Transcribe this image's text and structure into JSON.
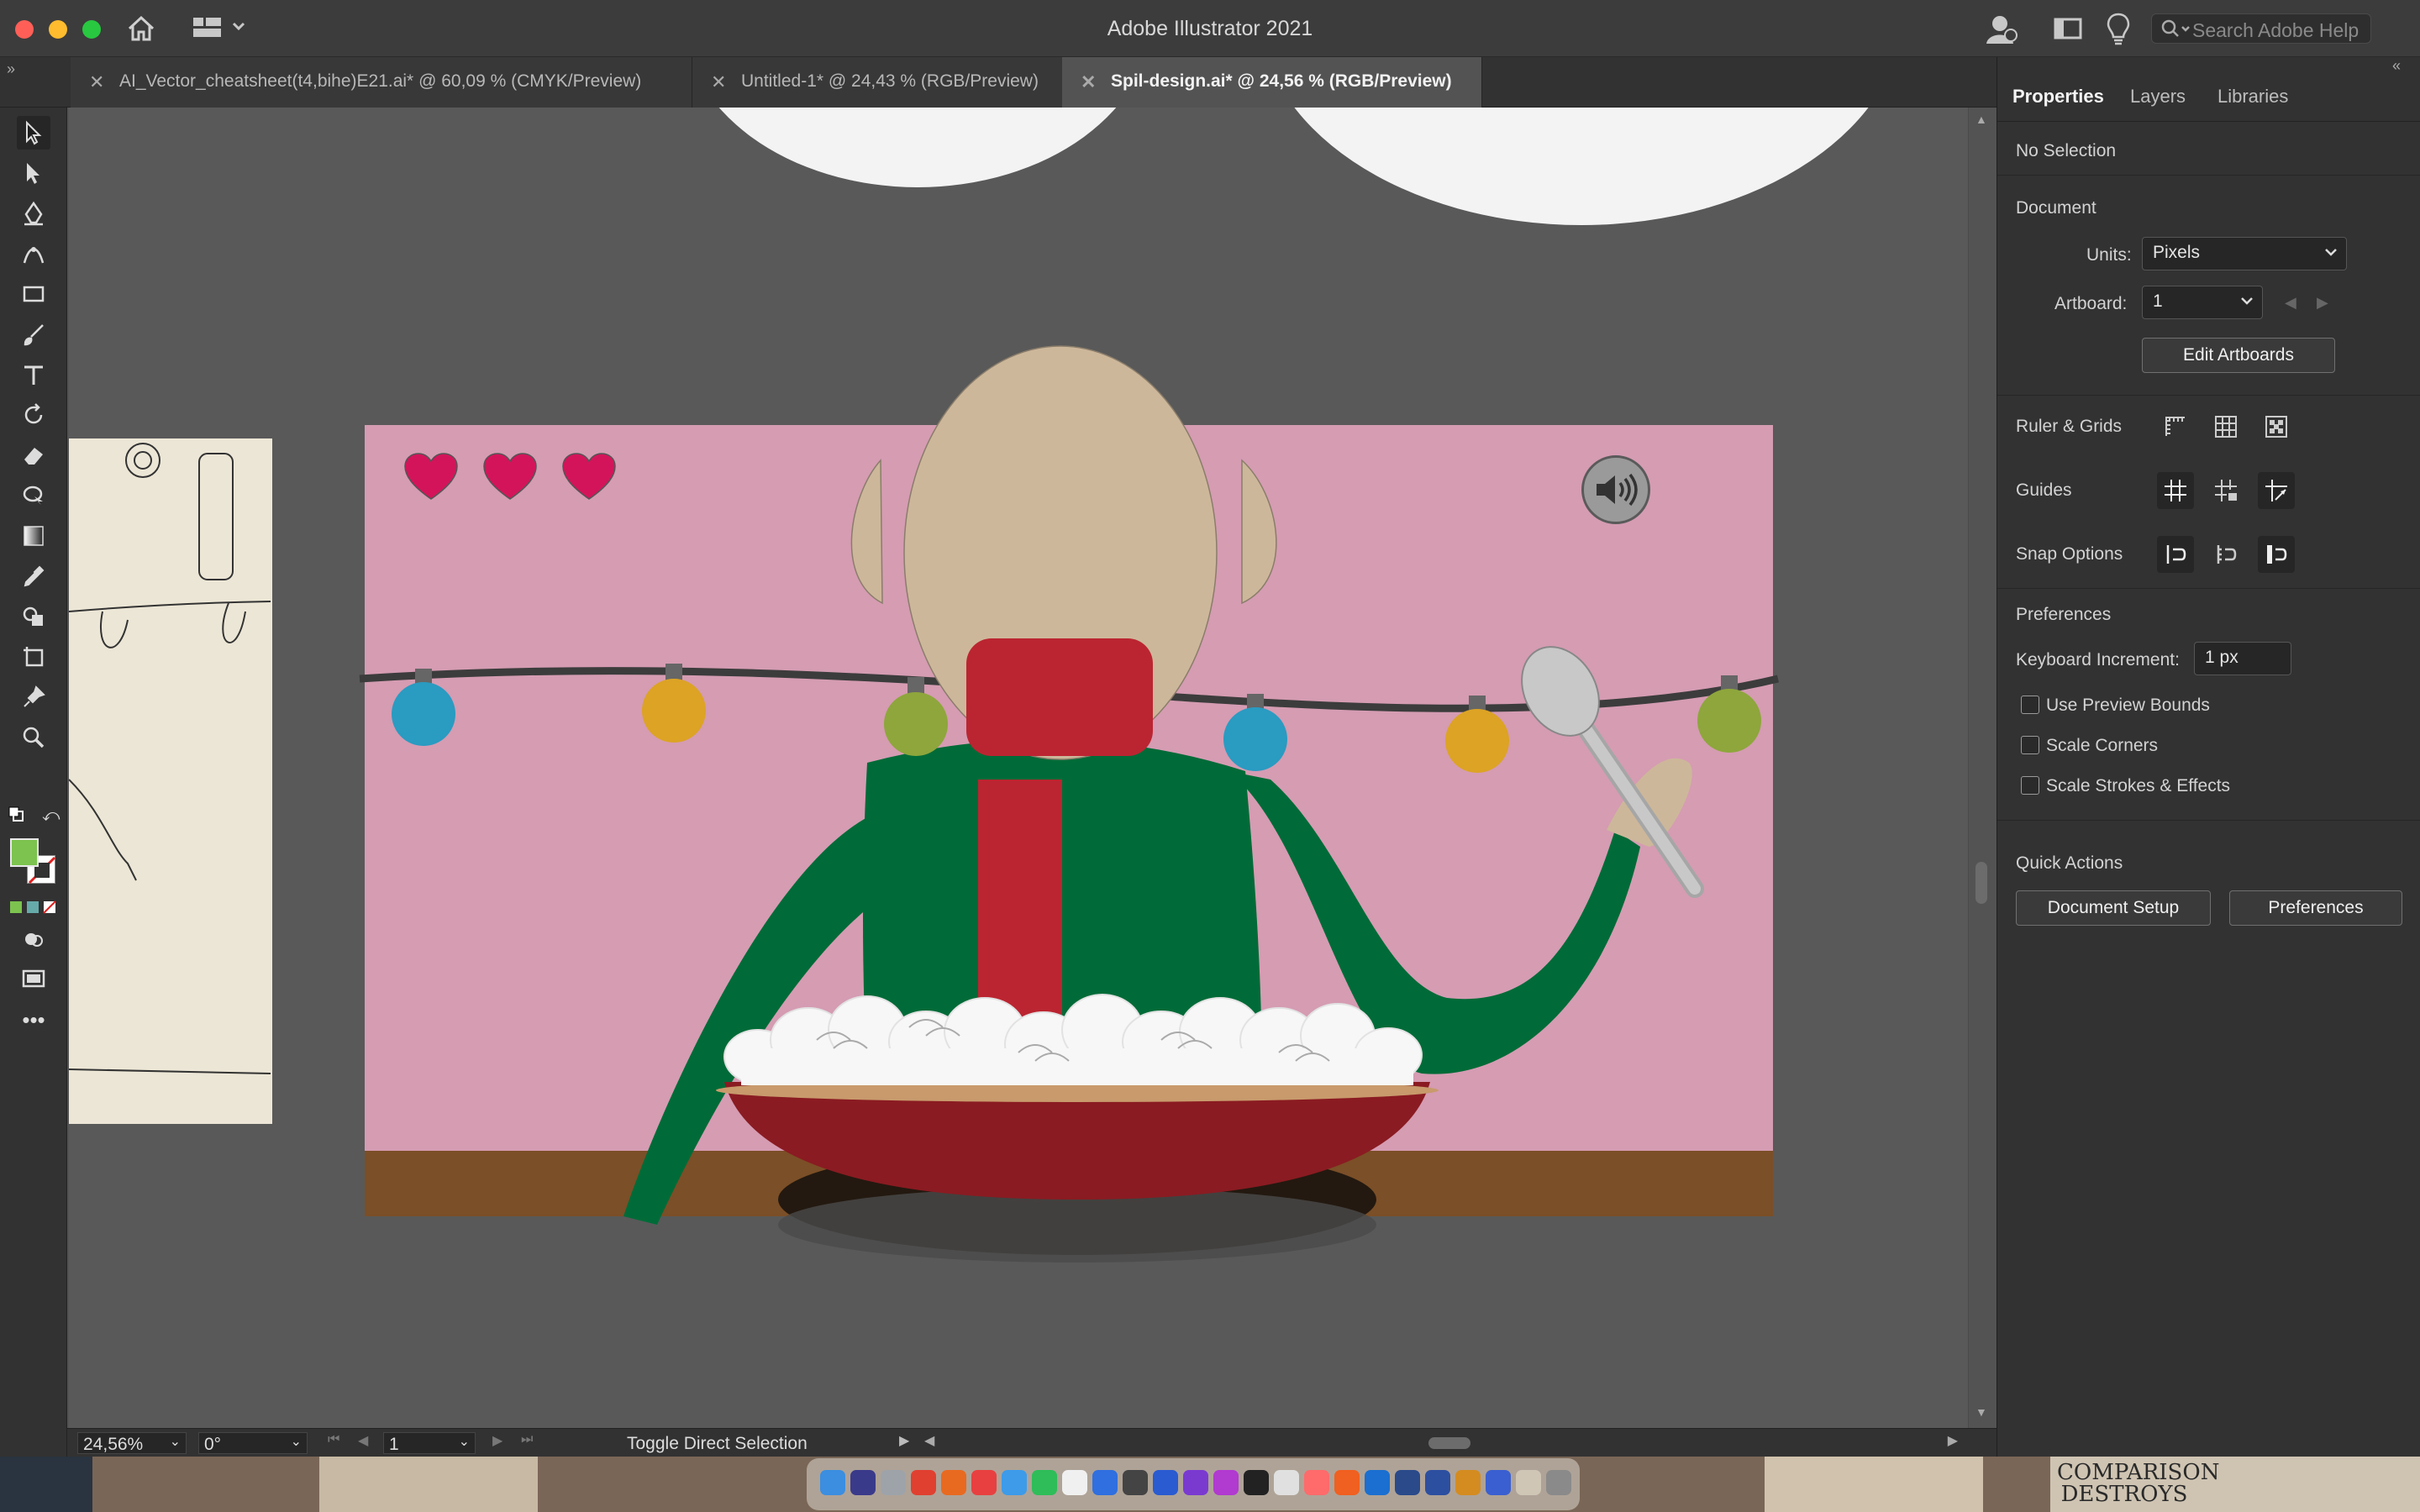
{
  "app": {
    "title": "Adobe Illustrator 2021",
    "search_placeholder": "Search Adobe Help"
  },
  "tabs": [
    {
      "label": "AI_Vector_cheatsheet(t4,bihe)E21.ai* @ 60,09 % (CMYK/Preview)",
      "active": false
    },
    {
      "label": "Untitled-1* @ 24,43 % (RGB/Preview)",
      "active": false
    },
    {
      "label": "Spil-design.ai* @ 24,56 % (RGB/Preview)",
      "active": true
    }
  ],
  "tools": [
    "selection-tool",
    "direct-selection-tool",
    "pen-tool",
    "curvature-tool",
    "rectangle-tool",
    "paintbrush-tool",
    "type-tool",
    "rotate-tool",
    "eraser-tool",
    "puppet-warp-tool",
    "gradient-tool",
    "eyedropper-tool",
    "shape-builder-tool",
    "artboard-tool",
    "pin-tool",
    "zoom-tool"
  ],
  "colors": {
    "fill": "#7cc34f",
    "artboard_bg": "#d59cb2",
    "table": "#7b4f27",
    "sweater": "#006b38",
    "scarf": "#bb2531",
    "head": "#cdb79a",
    "bowl": "#8a1b22",
    "heart": "#d4145a"
  },
  "panel": {
    "tabs": [
      "Properties",
      "Layers",
      "Libraries"
    ],
    "selection": "No Selection",
    "document_heading": "Document",
    "units_label": "Units:",
    "units_value": "Pixels",
    "artboard_label": "Artboard:",
    "artboard_value": "1",
    "edit_artboards": "Edit Artboards",
    "ruler_grids": "Ruler & Grids",
    "guides": "Guides",
    "snap_options": "Snap Options",
    "preferences_heading": "Preferences",
    "keyboard_increment_label": "Keyboard Increment:",
    "keyboard_increment_value": "1 px",
    "checkboxes": [
      {
        "label": "Use Preview Bounds",
        "checked": false
      },
      {
        "label": "Scale Corners",
        "checked": false
      },
      {
        "label": "Scale Strokes & Effects",
        "checked": false
      }
    ],
    "quick_actions": "Quick Actions",
    "document_setup": "Document Setup",
    "preferences_button": "Preferences"
  },
  "status": {
    "zoom": "24,56%",
    "rotation": "0°",
    "artboard": "1",
    "tool_hint": "Toggle Direct Selection"
  },
  "game": {
    "lives": 3,
    "sound_icon": "speaker-icon"
  },
  "wallpaper_text": "COMPARISON DESTROYS"
}
